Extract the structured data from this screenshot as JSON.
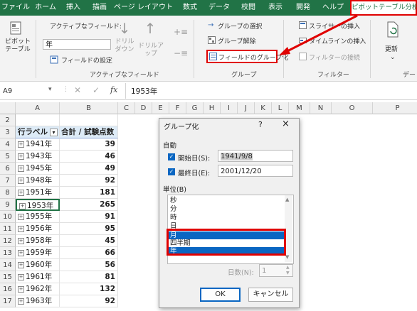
{
  "menu": {
    "tabs": [
      "ファイル",
      "ホーム",
      "挿入",
      "描画",
      "ページ レイアウト",
      "数式",
      "データ",
      "校閲",
      "表示",
      "開発",
      "ヘルプ",
      "ピボットテーブル分析"
    ]
  },
  "ribbon": {
    "pivot_table_label": "ピボットテーブル",
    "active_field_label": "アクティブなフィールド:",
    "active_field_value": "年",
    "drill_down": "ドリル ダウン",
    "drill_up": "ドリルアップ",
    "field_settings": "フィールドの設定",
    "group_active_field": "アクティブなフィールド",
    "group_selection": "グループの選択",
    "ungroup": "グループ解除",
    "group_field": "フィールドのグループ化",
    "group_group": "グループ",
    "insert_slicer": "スライサーの挿入",
    "insert_timeline": "タイムラインの挿入",
    "filter_connections": "フィルターの接続",
    "group_filter": "フィルター",
    "refresh": "更新",
    "group_data": "デー"
  },
  "formula_bar": {
    "name_box": "A9",
    "fx": "fx",
    "content": "1953年"
  },
  "grid": {
    "columns": [
      "A",
      "B",
      "C",
      "D",
      "E",
      "F",
      "G",
      "H",
      "I",
      "J",
      "K",
      "L",
      "M",
      "N",
      "O",
      "P"
    ],
    "rows": [
      {
        "num": "2",
        "a": "",
        "b": ""
      },
      {
        "num": "3",
        "a": "行ラベル",
        "b": "合計 / 試験点数"
      },
      {
        "num": "4",
        "a": "1941年",
        "b": "39"
      },
      {
        "num": "5",
        "a": "1943年",
        "b": "46"
      },
      {
        "num": "6",
        "a": "1945年",
        "b": "49"
      },
      {
        "num": "7",
        "a": "1948年",
        "b": "92"
      },
      {
        "num": "8",
        "a": "1951年",
        "b": "181"
      },
      {
        "num": "9",
        "a": "1953年",
        "b": "265"
      },
      {
        "num": "10",
        "a": "1955年",
        "b": "91"
      },
      {
        "num": "11",
        "a": "1956年",
        "b": "95"
      },
      {
        "num": "12",
        "a": "1958年",
        "b": "45"
      },
      {
        "num": "13",
        "a": "1959年",
        "b": "66"
      },
      {
        "num": "14",
        "a": "1960年",
        "b": "56"
      },
      {
        "num": "15",
        "a": "1961年",
        "b": "81"
      },
      {
        "num": "16",
        "a": "1962年",
        "b": "132"
      },
      {
        "num": "17",
        "a": "1963年",
        "b": "92"
      }
    ]
  },
  "dialog": {
    "title": "グループ化",
    "help": "?",
    "close": "×",
    "auto_label": "自動",
    "start_label": "開始日(S):",
    "start_value": "1941/9/8",
    "end_label": "最終日(E):",
    "end_value": "2001/12/20",
    "unit_label": "単位(B)",
    "units": [
      "秒",
      "分",
      "時",
      "日",
      "月",
      "四半期",
      "年"
    ],
    "days_label": "日数(N):",
    "days_value": "1",
    "ok": "OK",
    "cancel": "キャンセル"
  },
  "colors": {
    "excel_green": "#217346",
    "highlight_red": "#e00000",
    "selection_blue": "#0a66c2"
  }
}
